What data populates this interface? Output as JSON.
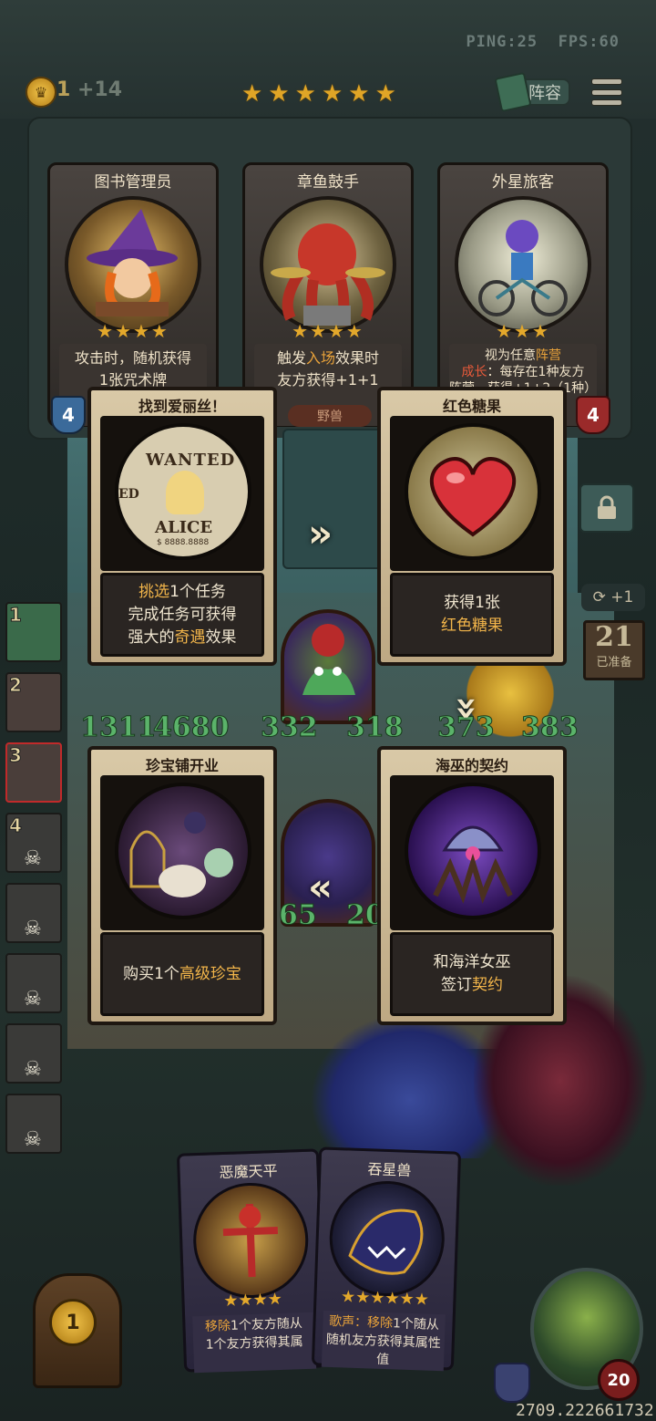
{
  "header": {
    "ping": "PING:25",
    "fps": "FPS:60",
    "gold": "1",
    "gold_income": "+14",
    "tavern_stars": 6,
    "lineup_label": "阵容"
  },
  "shop": {
    "cards": [
      {
        "name": "图书管理员",
        "stars": 4,
        "desc_lines": [
          "攻击时，随机获得",
          "1张咒术牌"
        ],
        "attack": "4"
      },
      {
        "name": "章鱼鼓手",
        "stars": 4,
        "desc_pre": "触发",
        "desc_hl": "入场",
        "desc_post": "效果时",
        "desc_line2": "友方获得+1+1"
      },
      {
        "name": "外星旅客",
        "stars": 3,
        "desc_pre": "视为任意",
        "desc_hl": "阵营",
        "desc_line2_hl": "成长",
        "desc_line2": "：每存在1种友方",
        "desc_line3": "阵营，获得+1+2（1种）",
        "health": "4"
      }
    ],
    "tribe_tag": "野兽"
  },
  "board": {
    "stats_row1": [
      "1311",
      "4680",
      "332",
      "318",
      "373",
      "383"
    ],
    "stats_row2": [
      "65",
      "20"
    ]
  },
  "players": [
    {
      "rank": "1",
      "dead": false
    },
    {
      "rank": "2",
      "dead": false
    },
    {
      "rank": "3",
      "dead": false,
      "current": true
    },
    {
      "rank": "4",
      "dead": true
    },
    {
      "rank": "",
      "dead": true
    },
    {
      "rank": "",
      "dead": true
    },
    {
      "rank": "",
      "dead": true
    },
    {
      "rank": "",
      "dead": true
    }
  ],
  "right_panel": {
    "refresh": "+1",
    "ready_count": "21",
    "ready_label": "已准备"
  },
  "events": [
    {
      "title": "找到爱丽丝！",
      "poster_top": "WANTED",
      "poster_bottom": "ALICE",
      "poster_side": "ED",
      "poster_reward": "$ 8888.8888",
      "l1_y": "挑选",
      "l1": "1个任务",
      "l2": "完成任务可获得",
      "l3a": "强大的",
      "l3_y": "奇遇",
      "l3b": "效果"
    },
    {
      "title": "红色糖果",
      "l1": "获得1张",
      "l2_y": "红色糖果"
    },
    {
      "title": "珍宝铺开业",
      "l1a": "购买1个",
      "l1_y": "高级珍宝"
    },
    {
      "title": "海巫的契约",
      "l1": "和海洋女巫",
      "l2a": "签订",
      "l2_y": "契约"
    }
  ],
  "hand": [
    {
      "name": "恶魔天平",
      "stars": 4,
      "desc_hl": "移除",
      "desc": "1个友方随从",
      "desc2": "1个友方获得其属"
    },
    {
      "name": "吞星兽",
      "stars": 6,
      "desc_hl": "歌声：移除",
      "desc": "1个随从",
      "desc2": "随机友方获得其属性值"
    }
  ],
  "bottom": {
    "sell_value": "1",
    "hero_health": "20",
    "seed": "2709.222661732"
  },
  "colors": {
    "accent": "#e0a526",
    "highlight": "#f2b54a",
    "hp": "#7a1d1d",
    "stat_green": "#5bb36a"
  }
}
